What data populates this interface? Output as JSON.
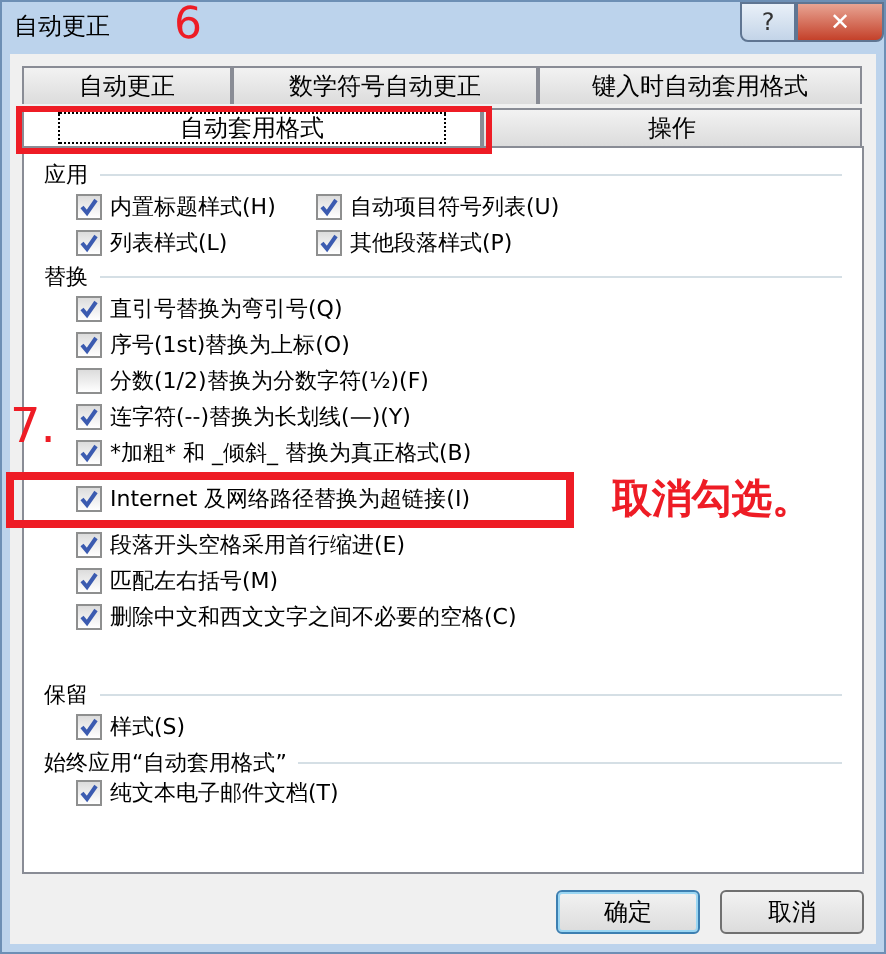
{
  "window": {
    "title": "自动更正",
    "buttons": [
      "?",
      "✕"
    ]
  },
  "tab_rows": [
    [
      {
        "label": "自动更正",
        "selected": false
      },
      {
        "label": "数学符号自动更正",
        "selected": false
      },
      {
        "label": "键入时自动套用格式",
        "selected": false
      }
    ],
    [
      {
        "label": "自动套用格式",
        "selected": true,
        "callout": "6"
      },
      {
        "label": "操作",
        "selected": false
      }
    ]
  ],
  "sections": [
    {
      "title": "应用",
      "kind": "grid",
      "options": [
        {
          "label": "内置标题样式(H)",
          "checked": true
        },
        {
          "label": "自动项目符号列表(U)",
          "checked": true
        },
        {
          "label": "列表样式(L)",
          "checked": true
        },
        {
          "label": "其他段落样式(P)",
          "checked": true
        }
      ]
    },
    {
      "title": "替换",
      "kind": "list",
      "options": [
        {
          "label": "直引号替换为弯引号(Q)",
          "checked": true
        },
        {
          "label": "序号(1st)替换为上标(O)",
          "checked": true
        },
        {
          "label": "分数(1/2)替换为分数字符(½)(F)",
          "checked": false
        },
        {
          "label": "连字符(--)替换为长划线(—)(Y)",
          "checked": true
        },
        {
          "label": "*加粗* 和 _倾斜_ 替换为真正格式(B)",
          "checked": true
        },
        {
          "label": "Internet 及网络路径替换为超链接(I)",
          "checked": true,
          "callout": "7.",
          "note": "取消勾选。"
        },
        {
          "label": "段落开头空格采用首行缩进(E)",
          "checked": true
        },
        {
          "label": "匹配左右括号(M)",
          "checked": true
        },
        {
          "label": "删除中文和西文文字之间不必要的空格(C)",
          "checked": true
        }
      ]
    },
    {
      "title": "保留",
      "kind": "list",
      "options": [
        {
          "label": "样式(S)",
          "checked": true
        }
      ]
    },
    {
      "title": "始终应用“自动套用格式”",
      "kind": "list",
      "options": [
        {
          "label": "纯文本电子邮件文档(T)",
          "checked": true
        }
      ]
    }
  ],
  "buttons": [
    {
      "label": "确定",
      "focused": true
    },
    {
      "label": "取消",
      "focused": false
    }
  ]
}
